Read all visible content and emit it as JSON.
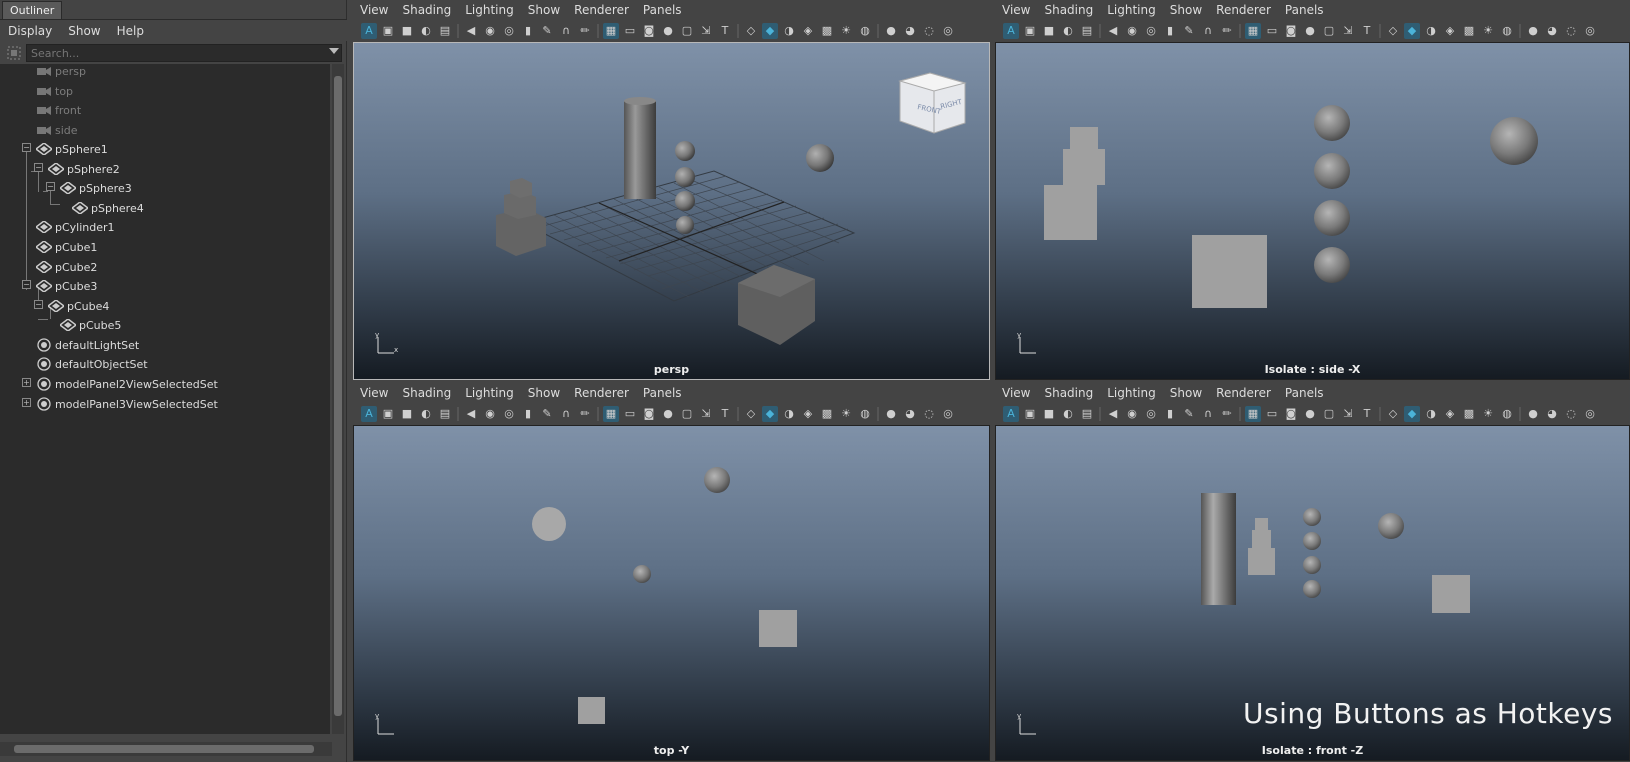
{
  "outliner": {
    "tab_title": "Outliner",
    "menu": [
      "Display",
      "Show",
      "Help"
    ],
    "search_placeholder": "Search...",
    "items": [
      {
        "label": "persp",
        "type": "camera"
      },
      {
        "label": "top",
        "type": "camera"
      },
      {
        "label": "front",
        "type": "camera"
      },
      {
        "label": "side",
        "type": "camera"
      },
      {
        "label": "pSphere1",
        "type": "mesh"
      },
      {
        "label": "pSphere2",
        "type": "mesh"
      },
      {
        "label": "pSphere3",
        "type": "mesh"
      },
      {
        "label": "pSphere4",
        "type": "mesh"
      },
      {
        "label": "pCylinder1",
        "type": "mesh"
      },
      {
        "label": "pCube1",
        "type": "mesh"
      },
      {
        "label": "pCube2",
        "type": "mesh"
      },
      {
        "label": "pCube3",
        "type": "mesh"
      },
      {
        "label": "pCube4",
        "type": "mesh"
      },
      {
        "label": "pCube5",
        "type": "mesh"
      },
      {
        "label": "defaultLightSet",
        "type": "set"
      },
      {
        "label": "defaultObjectSet",
        "type": "set"
      },
      {
        "label": "modelPanel2ViewSelectedSet",
        "type": "set"
      },
      {
        "label": "modelPanel3ViewSelectedSet",
        "type": "set"
      }
    ]
  },
  "panels": {
    "menu": [
      "View",
      "Shading",
      "Lighting",
      "Show",
      "Renderer",
      "Panels"
    ],
    "top_left_label": "persp",
    "top_right_label": "Isolate : side -X",
    "bottom_left_label": "top -Y",
    "bottom_right_label": "Isolate : front -Z"
  },
  "overlay": {
    "caption": "Using Buttons as Hotkeys"
  },
  "viewcube": {
    "front": "FRONT",
    "right": "RIGHT"
  },
  "axes": {
    "x": "x",
    "y": "y"
  },
  "colors": {
    "accent": "#4bb3d9",
    "viewport_top": "#7f91a8",
    "viewport_bottom": "#151b22"
  }
}
